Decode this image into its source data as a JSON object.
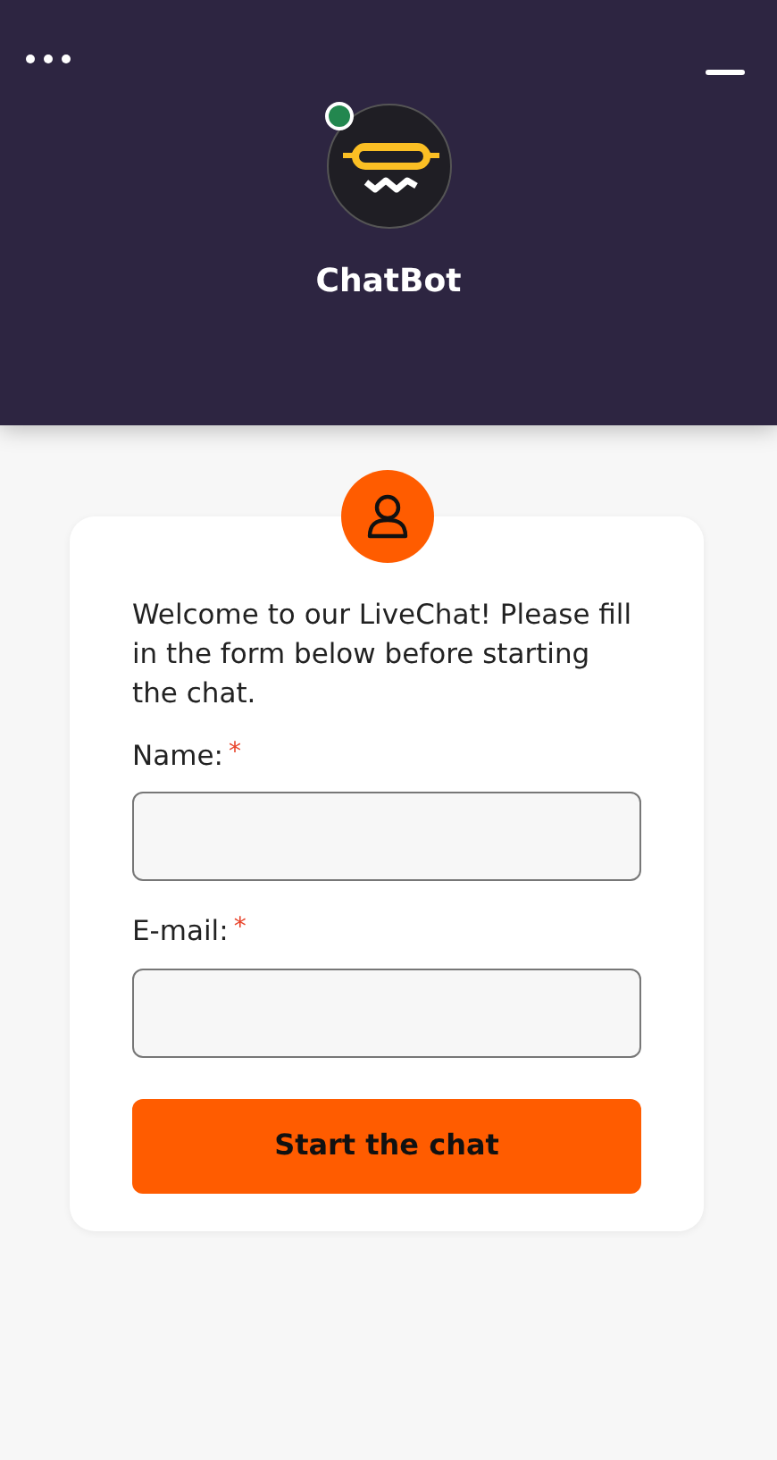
{
  "header": {
    "title": "ChatBot",
    "online": true
  },
  "form": {
    "intro": "Welcome to our LiveChat! Please fill in the form below before starting the chat.",
    "fields": [
      {
        "label": "Name:",
        "required_mark": "*"
      },
      {
        "label": "E-mail:",
        "required_mark": "*"
      }
    ],
    "submit": "Start the chat"
  }
}
